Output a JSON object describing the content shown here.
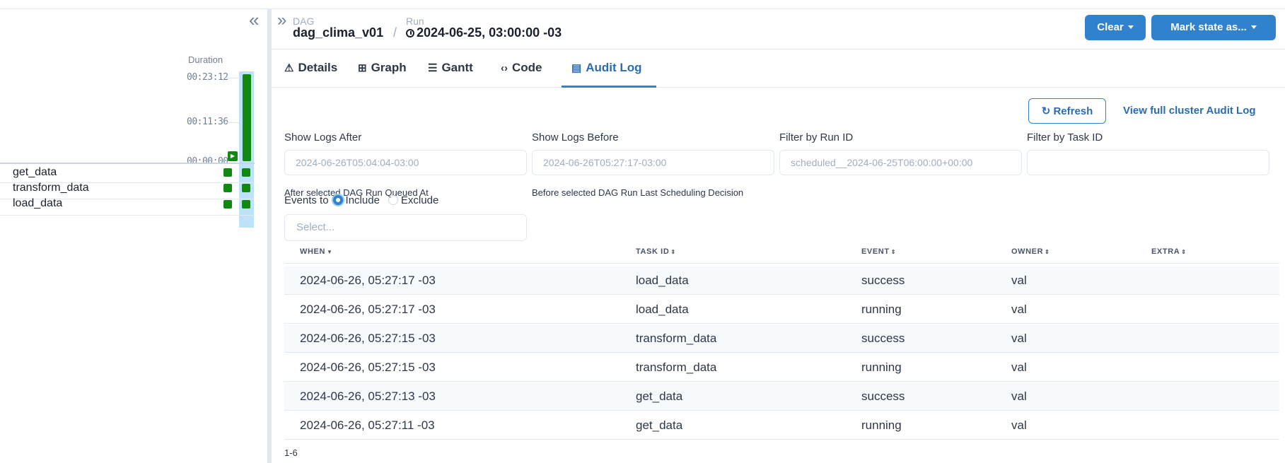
{
  "grid": {
    "duration_label": "Duration",
    "ticks": [
      "00:23:12",
      "00:11:36",
      "00:00:00"
    ],
    "tasks": [
      {
        "name": "get_data"
      },
      {
        "name": "transform_data"
      },
      {
        "name": "load_data"
      }
    ],
    "status_color": "#118811"
  },
  "header": {
    "dag_label": "DAG",
    "dag_value": "dag_clima_v01",
    "separator": "/",
    "run_label": "Run",
    "run_value": "2024-06-25, 03:00:00 -03",
    "clear_label": "Clear",
    "mark_state_label": "Mark state as..."
  },
  "tabs": [
    {
      "label": "Details",
      "icon": "warning-icon"
    },
    {
      "label": "Graph",
      "icon": "graph-icon"
    },
    {
      "label": "Gantt",
      "icon": "gantt-icon"
    },
    {
      "label": "Code",
      "icon": "code-icon"
    },
    {
      "label": "Audit Log",
      "icon": "audit-log-icon",
      "active": true
    }
  ],
  "audit": {
    "refresh_label": "Refresh",
    "full_log_link": "View full cluster Audit Log",
    "filters": {
      "after_label": "Show Logs After",
      "after_value": "2024-06-26T05:04:04-03:00",
      "after_help": "After selected DAG Run Queued At",
      "before_label": "Show Logs Before",
      "before_value": "2024-06-26T05:27:17-03:00",
      "before_help": "Before selected DAG Run Last Scheduling Decision",
      "run_id_label": "Filter by Run ID",
      "run_id_placeholder": "scheduled__2024-06-25T06:00:00+00:00",
      "task_id_label": "Filter by Task ID",
      "task_id_placeholder": ""
    },
    "events_to_label": "Events to",
    "include_label": "Include",
    "exclude_label": "Exclude",
    "events_selected": "include",
    "select_placeholder": "Select...",
    "columns": [
      "WHEN",
      "TASK ID",
      "EVENT",
      "OWNER",
      "EXTRA"
    ],
    "rows": [
      {
        "when": "2024-06-26, 05:27:17 -03",
        "task_id": "load_data",
        "event": "success",
        "owner": "val",
        "extra": ""
      },
      {
        "when": "2024-06-26, 05:27:17 -03",
        "task_id": "load_data",
        "event": "running",
        "owner": "val",
        "extra": ""
      },
      {
        "when": "2024-06-26, 05:27:15 -03",
        "task_id": "transform_data",
        "event": "success",
        "owner": "val",
        "extra": ""
      },
      {
        "when": "2024-06-26, 05:27:15 -03",
        "task_id": "transform_data",
        "event": "running",
        "owner": "val",
        "extra": ""
      },
      {
        "when": "2024-06-26, 05:27:13 -03",
        "task_id": "get_data",
        "event": "success",
        "owner": "val",
        "extra": ""
      },
      {
        "when": "2024-06-26, 05:27:11 -03",
        "task_id": "get_data",
        "event": "running",
        "owner": "val",
        "extra": ""
      }
    ],
    "pagination_text": "1-6"
  }
}
